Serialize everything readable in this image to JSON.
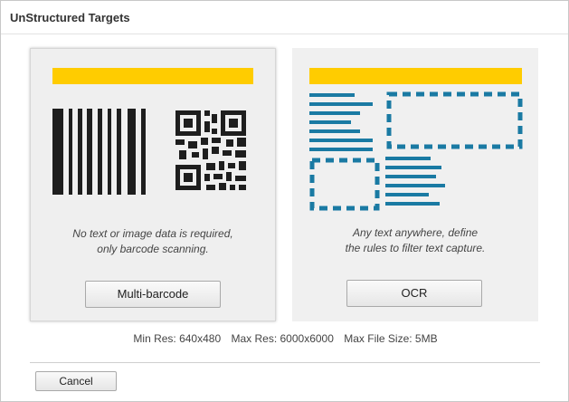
{
  "dialog": {
    "title": "UnStructured Targets"
  },
  "options": [
    {
      "id": "multi-barcode",
      "description_line1": "No text or image data is required,",
      "description_line2": "only barcode scanning.",
      "button_label": "Multi-barcode",
      "icon": "barcode-qr-illustration"
    },
    {
      "id": "ocr",
      "description_line1": "Any text anywhere, define",
      "description_line2": "the rules to filter text capture.",
      "button_label": "OCR",
      "icon": "ocr-text-regions-illustration"
    }
  ],
  "resolution": {
    "min_res": "Min Res: 640x480",
    "max_res": "Max Res: 6000x6000",
    "max_file_size": "Max File Size: 5MB"
  },
  "footer": {
    "cancel_label": "Cancel"
  },
  "colors": {
    "accent_yellow": "#ffcc00",
    "ocr_blue": "#1a7aa3",
    "barcode_black": "#1e1e1e",
    "card_bg": "#efefef"
  }
}
